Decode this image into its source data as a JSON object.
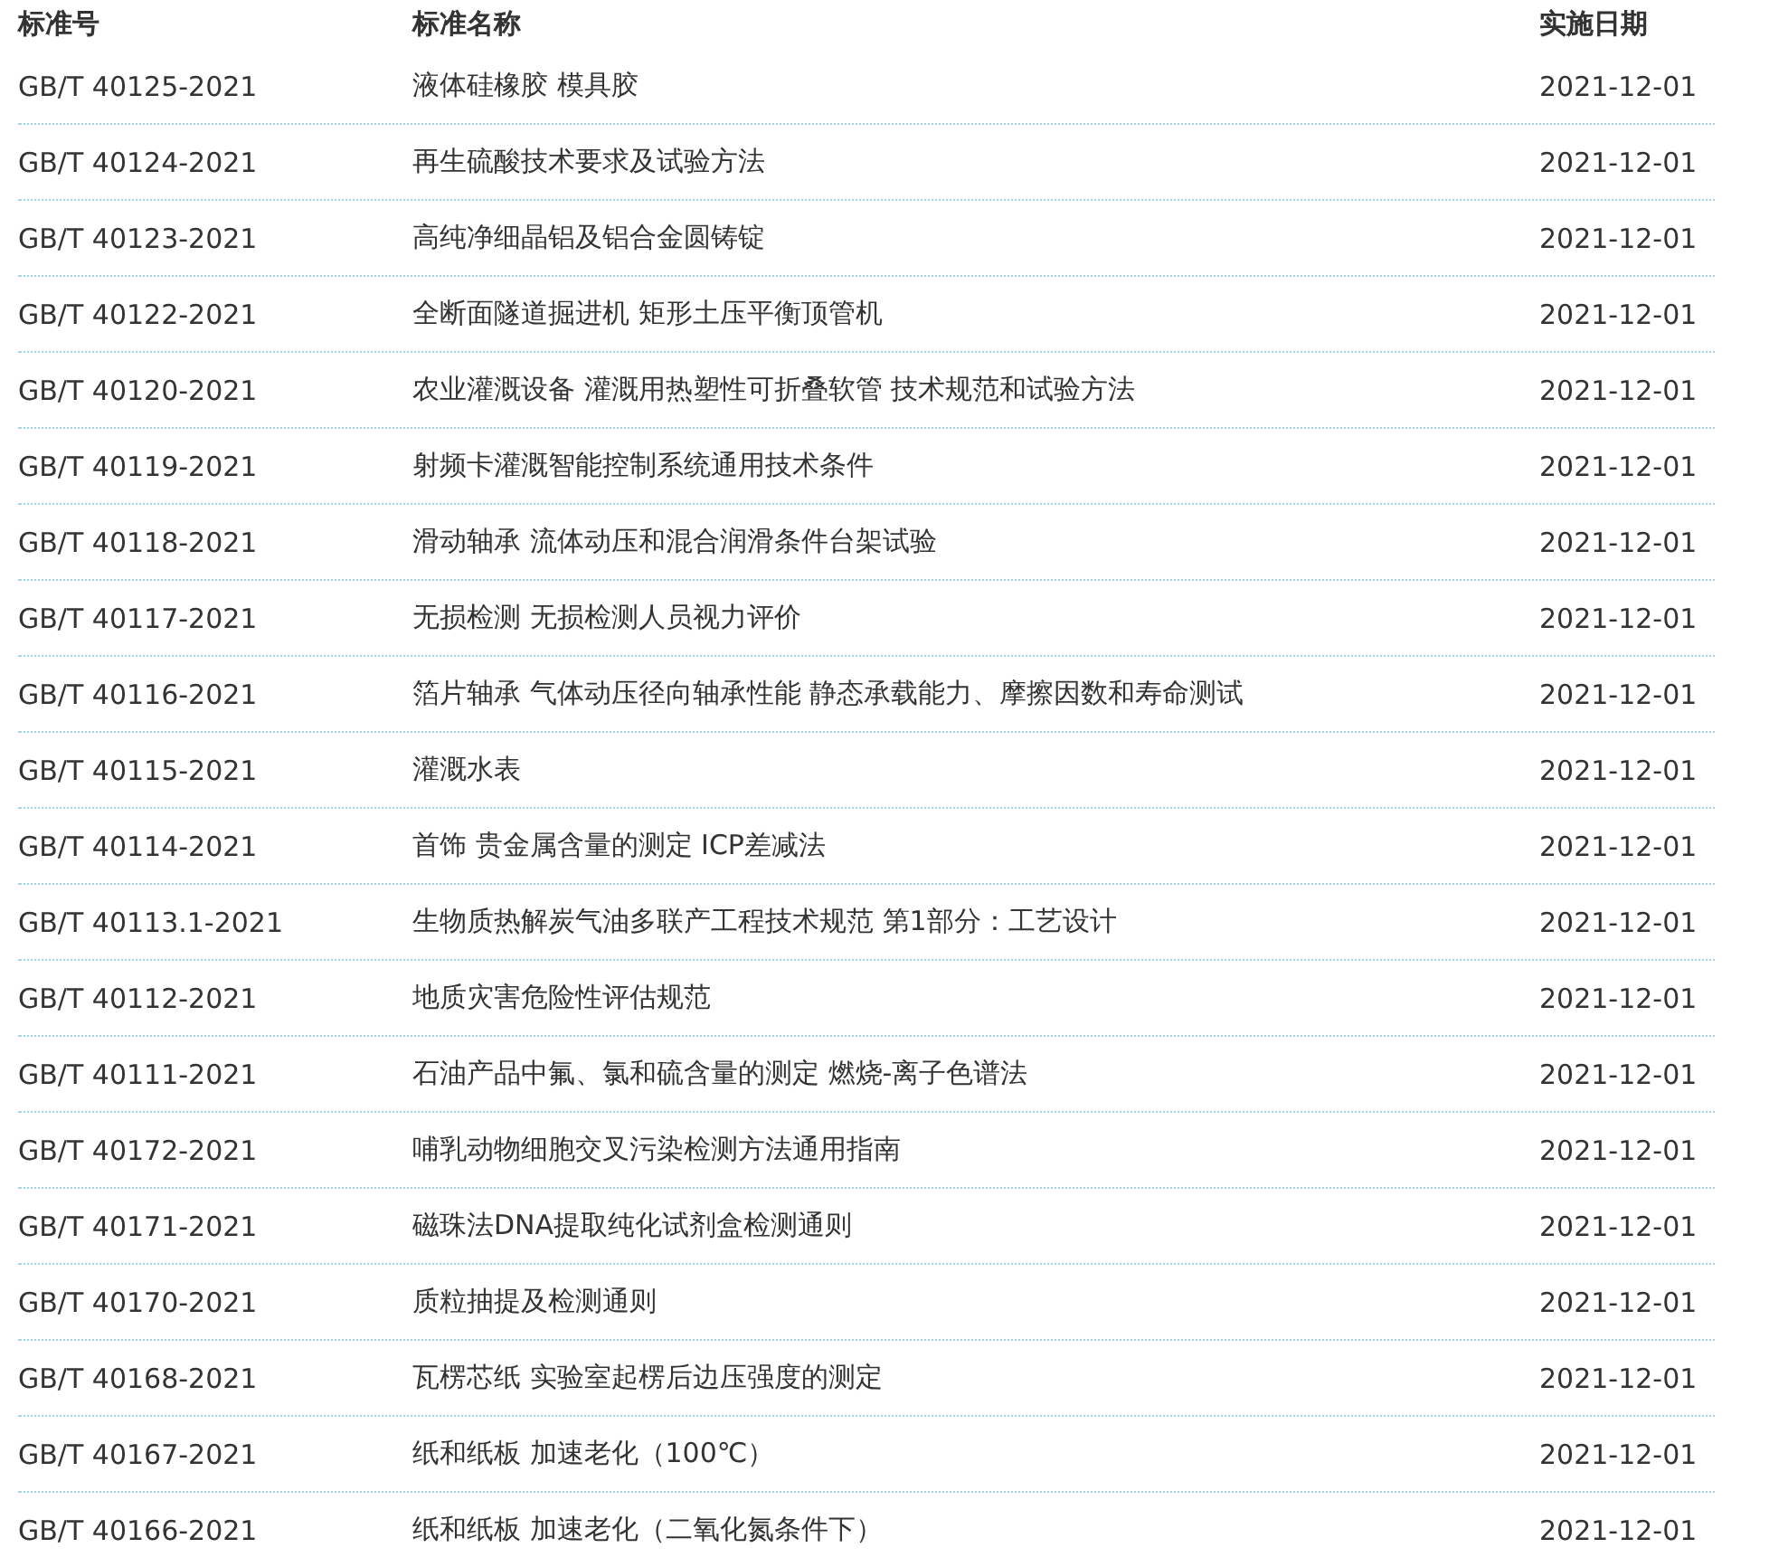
{
  "table": {
    "columns": [
      "标准号",
      "标准名称",
      "实施日期"
    ],
    "rows": [
      [
        "GB/T 40125-2021",
        "液体硅橡胶 模具胶",
        "2021-12-01"
      ],
      [
        "GB/T 40124-2021",
        "再生硫酸技术要求及试验方法",
        "2021-12-01"
      ],
      [
        "GB/T 40123-2021",
        "高纯净细晶铝及铝合金圆铸锭",
        "2021-12-01"
      ],
      [
        "GB/T 40122-2021",
        "全断面隧道掘进机 矩形土压平衡顶管机",
        "2021-12-01"
      ],
      [
        "GB/T 40120-2021",
        "农业灌溉设备 灌溉用热塑性可折叠软管 技术规范和试验方法",
        "2021-12-01"
      ],
      [
        "GB/T 40119-2021",
        "射频卡灌溉智能控制系统通用技术条件",
        "2021-12-01"
      ],
      [
        "GB/T 40118-2021",
        "滑动轴承 流体动压和混合润滑条件台架试验",
        "2021-12-01"
      ],
      [
        "GB/T 40117-2021",
        "无损检测 无损检测人员视力评价",
        "2021-12-01"
      ],
      [
        "GB/T 40116-2021",
        "箔片轴承 气体动压径向轴承性能 静态承载能力、摩擦因数和寿命测试",
        "2021-12-01"
      ],
      [
        "GB/T 40115-2021",
        "灌溉水表",
        "2021-12-01"
      ],
      [
        "GB/T 40114-2021",
        "首饰 贵金属含量的测定 ICP差减法",
        "2021-12-01"
      ],
      [
        "GB/T 40113.1-2021",
        "生物质热解炭气油多联产工程技术规范 第1部分：工艺设计",
        "2021-12-01"
      ],
      [
        "GB/T 40112-2021",
        "地质灾害危险性评估规范",
        "2021-12-01"
      ],
      [
        "GB/T 40111-2021",
        "石油产品中氟、氯和硫含量的测定 燃烧-离子色谱法",
        "2021-12-01"
      ],
      [
        "GB/T 40172-2021",
        "哺乳动物细胞交叉污染检测方法通用指南",
        "2021-12-01"
      ],
      [
        "GB/T 40171-2021",
        "磁珠法DNA提取纯化试剂盒检测通则",
        "2021-12-01"
      ],
      [
        "GB/T 40170-2021",
        "质粒抽提及检测通则",
        "2021-12-01"
      ],
      [
        "GB/T 40168-2021",
        "瓦楞芯纸 实验室起楞后边压强度的测定",
        "2021-12-01"
      ],
      [
        "GB/T 40167-2021",
        "纸和纸板 加速老化（100℃）",
        "2021-12-01"
      ],
      [
        "GB/T 40166-2021",
        "纸和纸板 加速老化（二氧化氮条件下）",
        "2021-12-01"
      ]
    ]
  }
}
